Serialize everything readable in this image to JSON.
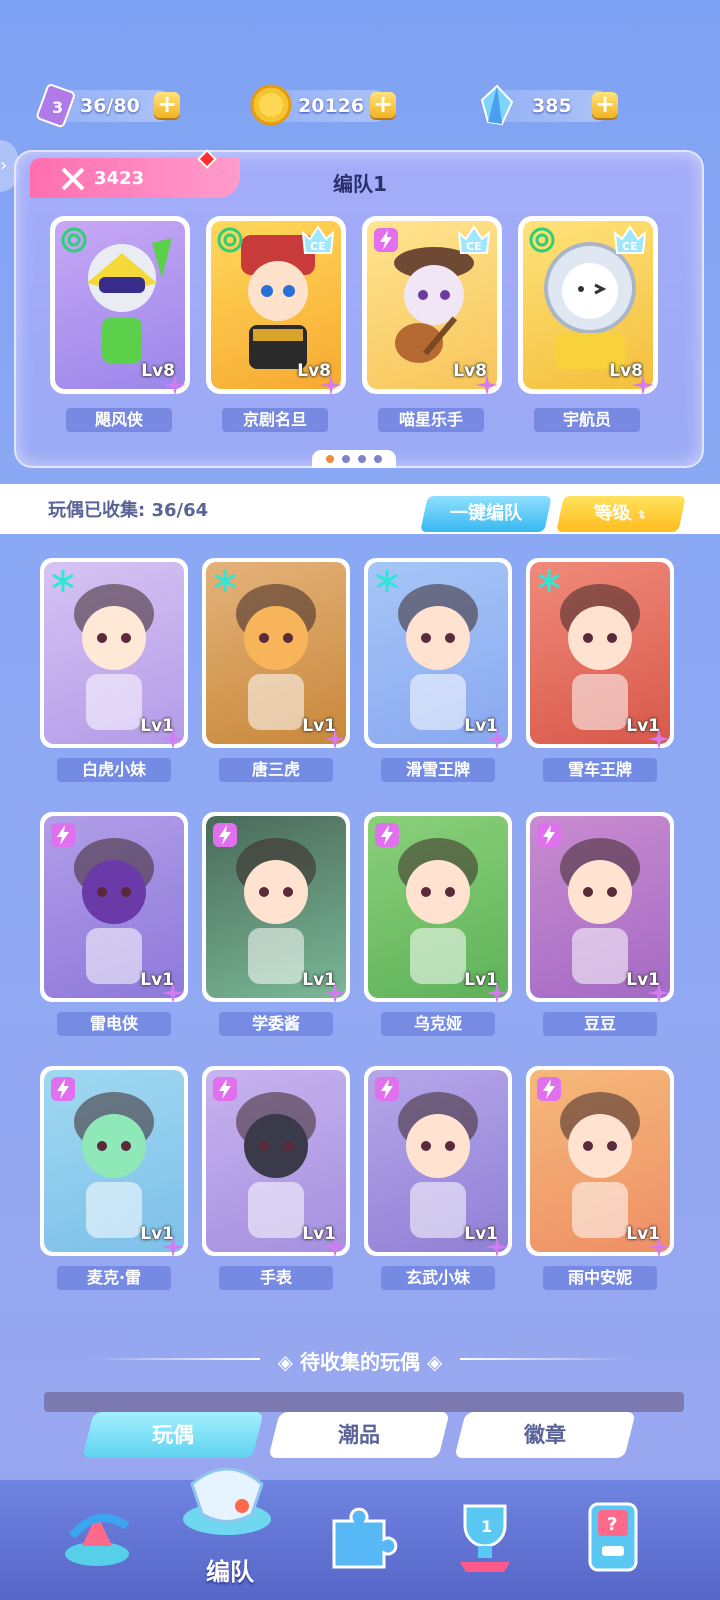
{
  "resources": {
    "tickets": "36/80",
    "coins": "20126",
    "gems": "385"
  },
  "team": {
    "power": "3423",
    "title": "编队1",
    "members": [
      {
        "name": "飓风侠",
        "level": "Lv8",
        "rarity": "spiral"
      },
      {
        "name": "京剧名旦",
        "level": "Lv8",
        "rarity": "spiral"
      },
      {
        "name": "喵星乐手",
        "level": "Lv8",
        "rarity": "bolt"
      },
      {
        "name": "宇航员",
        "level": "Lv8",
        "rarity": "spiral"
      }
    ]
  },
  "collection": {
    "label": "玩偶已收集:",
    "count": "36/64",
    "auto_team_btn": "一键编队",
    "sort_btn": "等级"
  },
  "dolls": [
    {
      "name": "白虎小妹",
      "level": "Lv1",
      "rarity": "snow"
    },
    {
      "name": "唐三虎",
      "level": "Lv1",
      "rarity": "snow"
    },
    {
      "name": "滑雪王牌",
      "level": "Lv1",
      "rarity": "snow"
    },
    {
      "name": "雪车王牌",
      "level": "Lv1",
      "rarity": "snow"
    },
    {
      "name": "雷电侠",
      "level": "Lv1",
      "rarity": "bolt"
    },
    {
      "name": "学委酱",
      "level": "Lv1",
      "rarity": "bolt"
    },
    {
      "name": "乌克娅",
      "level": "Lv1",
      "rarity": "bolt"
    },
    {
      "name": "豆豆",
      "level": "Lv1",
      "rarity": "bolt"
    },
    {
      "name": "麦克·雷",
      "level": "Lv1",
      "rarity": "bolt"
    },
    {
      "name": "手表",
      "level": "Lv1",
      "rarity": "bolt"
    },
    {
      "name": "玄武小妹",
      "level": "Lv1",
      "rarity": "bolt"
    },
    {
      "name": "雨中安妮",
      "level": "Lv1",
      "rarity": "bolt"
    }
  ],
  "pending_title": "◈ 待收集的玩偶 ◈",
  "tabs": [
    "玩偶",
    "潮品",
    "徽章"
  ],
  "nav": {
    "active_label": "编队"
  }
}
